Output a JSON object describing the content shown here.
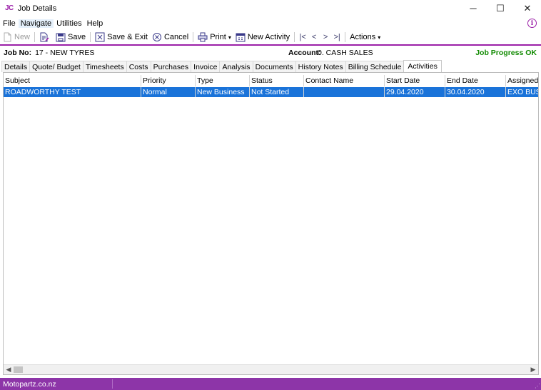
{
  "window": {
    "logo": "JC",
    "title": "Job Details",
    "minimize_glyph": "─",
    "maximize_glyph": "☐",
    "close_glyph": "✕"
  },
  "menu": {
    "items": [
      "File",
      "Navigate",
      "Utilities",
      "Help"
    ],
    "info_glyph": "i"
  },
  "toolbar": {
    "new": "New",
    "save": "Save",
    "save_exit": "Save & Exit",
    "cancel": "Cancel",
    "print": "Print",
    "print_arrow": "▾",
    "new_activity": "New Activity",
    "nav_first": "|<",
    "nav_prev": "<",
    "nav_next": ">",
    "nav_last": ">|",
    "actions": "Actions",
    "actions_arrow": "▾"
  },
  "job": {
    "label": "Job No:",
    "value": "17 - NEW TYRES",
    "account_label": "Account:",
    "account_value": "0. CASH SALES",
    "progress": "Job Progress OK"
  },
  "tabs": [
    "Details",
    "Quote/ Budget",
    "Timesheets",
    "Costs",
    "Purchases",
    "Invoice",
    "Analysis",
    "Documents",
    "History Notes",
    "Billing Schedule",
    "Activities"
  ],
  "active_tab": "Activities",
  "grid": {
    "columns": [
      "Subject",
      "Priority",
      "Type",
      "Status",
      "Contact Name",
      "Start Date",
      "End Date",
      "Assigned T"
    ],
    "rows": [
      [
        "ROADWORTHY TEST",
        "Normal",
        "New Business",
        "Not Started",
        "",
        "29.04.2020",
        "30.04.2020",
        "EXO BUSIN"
      ]
    ],
    "scroll_left": "◀",
    "scroll_right": "▶"
  },
  "status": {
    "text": "Motopartz.co.nz",
    "grip": "⋰"
  },
  "colors": {
    "accent": "#9b1fa8",
    "status_bar": "#8d35a8",
    "selection": "#1a73d9",
    "progress_ok": "#108a00"
  }
}
